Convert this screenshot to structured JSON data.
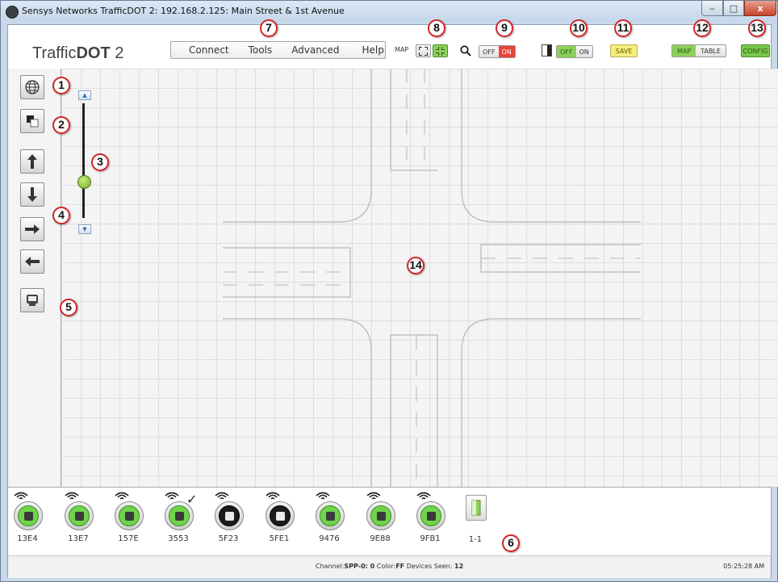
{
  "window": {
    "title": "Sensys Networks TrafficDOT 2: 192.168.2.125: Main Street & 1st Avenue",
    "controls": {
      "minimize": "‒",
      "maximize": "□",
      "close": "x"
    }
  },
  "toolbar": {
    "logo_prefix": "Traffic",
    "logo_bold": "DOT",
    "logo_suffix": " 2",
    "menu": [
      "Connect",
      "Tools",
      "Advanced",
      "Help"
    ],
    "map_label": "MAP",
    "zoom_toggle": {
      "off": "OFF",
      "on": "ON",
      "selected": "ON"
    },
    "panel_toggle": {
      "off": "OFF",
      "on": "ON",
      "selected": "OFF"
    },
    "save_label": "SAVE",
    "view": {
      "map": "MAP",
      "table": "TABLE",
      "selected": "MAP"
    },
    "config_label": "CONFIG"
  },
  "sidebar": {
    "tools": [
      "globe-icon",
      "layers-icon",
      "arrow-up-icon",
      "arrow-down-icon",
      "arrow-right-icon",
      "arrow-left-icon",
      "sensor-icon"
    ]
  },
  "zoom": {
    "level": 0.3
  },
  "devices": [
    {
      "id": "13E4",
      "status": "green"
    },
    {
      "id": "13E7",
      "status": "green"
    },
    {
      "id": "157E",
      "status": "green"
    },
    {
      "id": "3553",
      "status": "green",
      "checked": true
    },
    {
      "id": "5F23",
      "status": "black"
    },
    {
      "id": "5FE1",
      "status": "black"
    },
    {
      "id": "9476",
      "status": "green"
    },
    {
      "id": "9E88",
      "status": "green"
    },
    {
      "id": "9FB1",
      "status": "green"
    }
  ],
  "repeater": {
    "label": "1-1"
  },
  "status": {
    "channel_label": "Channel:",
    "channel_value": "SPP-0: 0",
    "color_label": "Color:",
    "color_value": "FF",
    "devices_label": "Devices Seen:",
    "devices_value": "12",
    "time": "05:25:28 AM"
  },
  "callouts": [
    "1",
    "2",
    "3",
    "4",
    "5",
    "6",
    "7",
    "8",
    "9",
    "10",
    "11",
    "12",
    "13",
    "14"
  ]
}
